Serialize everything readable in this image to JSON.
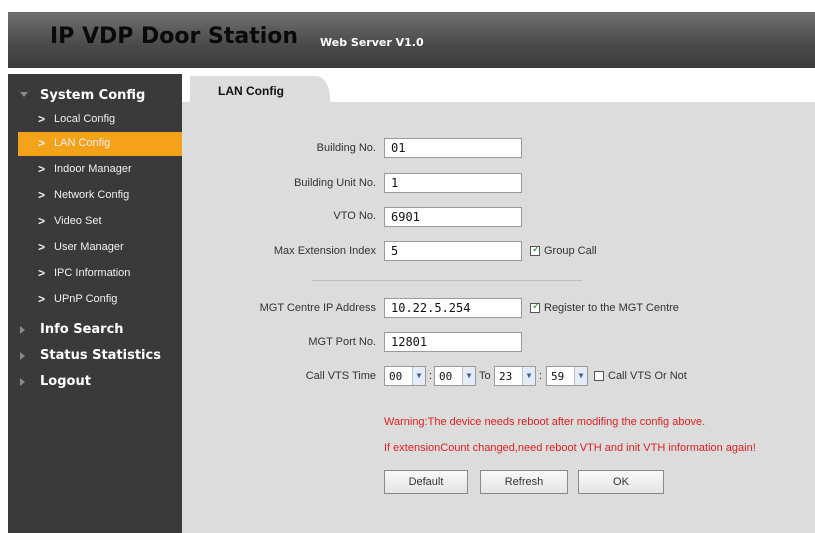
{
  "header": {
    "title": "IP VDP Door Station",
    "subtitle": "Web Server V1.0"
  },
  "sidebar": {
    "groups": [
      {
        "label": "System Config",
        "expanded": true,
        "icon": "triangle-down-icon"
      },
      {
        "label": "Info Search",
        "expanded": false,
        "icon": "triangle-right-icon"
      },
      {
        "label": "Status Statistics",
        "expanded": false,
        "icon": "triangle-right-icon"
      },
      {
        "label": "Logout",
        "expanded": false,
        "icon": "triangle-right-icon"
      }
    ],
    "items": [
      {
        "label": "Local Config"
      },
      {
        "label": "LAN Config",
        "active": true
      },
      {
        "label": "Indoor Manager"
      },
      {
        "label": "Network Config"
      },
      {
        "label": "Video Set"
      },
      {
        "label": "User Manager"
      },
      {
        "label": "IPC Information"
      },
      {
        "label": "UPnP Config"
      }
    ],
    "chevron": ">",
    "active_color": "#f5a21b"
  },
  "tab": {
    "label": "LAN Config"
  },
  "form": {
    "building_no": {
      "label": "Building No.",
      "value": "01"
    },
    "building_unit_no": {
      "label": "Building Unit No.",
      "value": "1"
    },
    "vto_no": {
      "label": "VTO No.",
      "value": "6901"
    },
    "max_extension_index": {
      "label": "Max Extension Index",
      "value": "5"
    },
    "group_call": {
      "label": "Group Call",
      "checked": true
    },
    "mgt_ip": {
      "label": "MGT Centre IP Address",
      "value": "10.22.5.254"
    },
    "register_mgt": {
      "label": "Register to the MGT Centre",
      "checked": true
    },
    "mgt_port": {
      "label": "MGT Port No.",
      "value": "12801"
    },
    "call_vts_time": {
      "label": "Call VTS Time",
      "start_hour": "00",
      "start_min": "00",
      "to": "To",
      "end_hour": "23",
      "end_min": "59",
      "separator": ":"
    },
    "call_vts_or_not": {
      "label": "Call VTS Or Not",
      "checked": false
    },
    "check_mark": "✓",
    "dropdown_arrow": "▼"
  },
  "warnings": {
    "reboot": "Warning:The device needs reboot after modifing the config above.",
    "extension": "If extensionCount changed,need reboot VTH and init VTH information again!",
    "color": "#e02020"
  },
  "buttons": {
    "default": "Default",
    "refresh": "Refresh",
    "ok": "OK"
  }
}
